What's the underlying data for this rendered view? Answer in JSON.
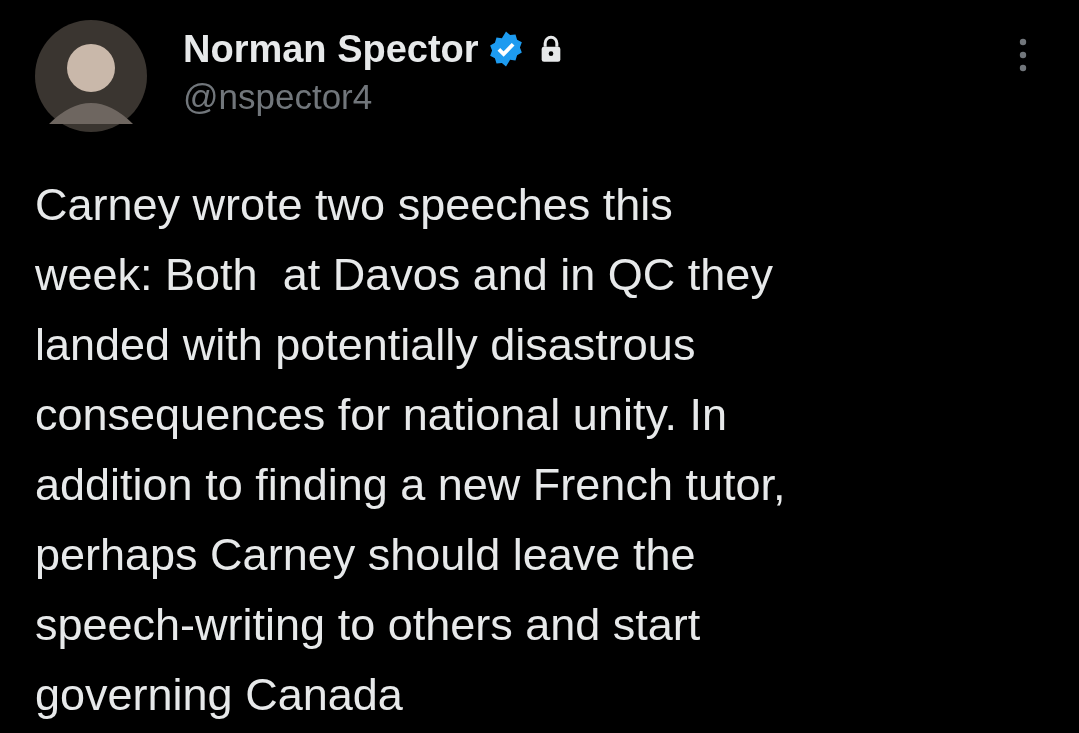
{
  "author": {
    "name": "Norman Spector",
    "handle": "@nspector4",
    "verified": true,
    "protected": true
  },
  "post": {
    "text": "Carney wrote two speeches this\nweek: Both  at Davos and in QC they\nlanded with potentially disastrous\nconsequences for national unity. In\naddition to finding a new French tutor,\nperhaps Carney should leave the\nspeech-writing to others and start\ngoverning Canada"
  }
}
